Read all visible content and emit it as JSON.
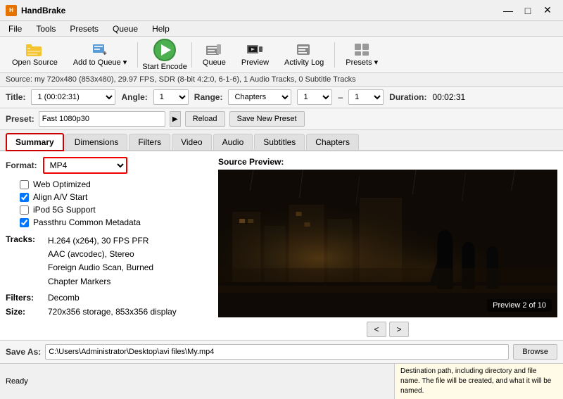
{
  "app": {
    "title": "HandBrake",
    "title_full": "HandBrake"
  },
  "titlebar": {
    "minimize": "—",
    "maximize": "□",
    "close": "✕"
  },
  "menubar": {
    "items": [
      "File",
      "Tools",
      "Presets",
      "Queue",
      "Help"
    ]
  },
  "toolbar": {
    "open_source": "Open Source",
    "add_to_queue": "Add to Queue",
    "start_encode": "Start Encode",
    "queue": "Queue",
    "preview": "Preview",
    "activity_log": "Activity Log",
    "presets": "Presets"
  },
  "source_bar": {
    "text": "Source: my  720x480 (853x480), 29.97 FPS, SDR (8-bit 4:2:0, 6-1-6), 1 Audio Tracks, 0 Subtitle Tracks"
  },
  "title_row": {
    "title_label": "Title:",
    "title_value": "1 (00:02:31)",
    "angle_label": "Angle:",
    "angle_value": "1",
    "range_label": "Range:",
    "range_value": "Chapters",
    "range_from": "1",
    "range_to": "1",
    "duration_label": "Duration:",
    "duration_value": "00:02:31"
  },
  "preset_row": {
    "label": "Preset:",
    "value": "Fast 1080p30",
    "reload_btn": "Reload",
    "save_btn": "Save New Preset"
  },
  "tabs": [
    {
      "label": "Summary",
      "active": true,
      "highlight": true
    },
    {
      "label": "Dimensions",
      "active": false
    },
    {
      "label": "Filters",
      "active": false
    },
    {
      "label": "Video",
      "active": false
    },
    {
      "label": "Audio",
      "active": false
    },
    {
      "label": "Subtitles",
      "active": false
    },
    {
      "label": "Chapters",
      "active": false
    }
  ],
  "summary": {
    "format_label": "Format:",
    "format_value": "MP4",
    "checkboxes": [
      {
        "label": "Web Optimized",
        "checked": false
      },
      {
        "label": "Align A/V Start",
        "checked": true
      },
      {
        "label": "iPod 5G Support",
        "checked": false
      },
      {
        "label": "Passthru Common Metadata",
        "checked": true
      }
    ],
    "tracks_label": "Tracks:",
    "tracks": [
      "H.264 (x264), 30 FPS PFR",
      "AAC (avcodec), Stereo",
      "Foreign Audio Scan, Burned",
      "Chapter Markers"
    ],
    "filters_label": "Filters:",
    "filters_value": "Decomb",
    "size_label": "Size:",
    "size_value": "720x356 storage, 853x356 display"
  },
  "preview": {
    "label": "Source Preview:",
    "counter": "Preview 2 of 10",
    "prev_btn": "<",
    "next_btn": ">"
  },
  "save": {
    "label": "Save As:",
    "path": "C:\\Users\\Administrator\\Desktop\\avi files\\My.mp4",
    "browse_btn": "Browse"
  },
  "statusbar": {
    "status": "Ready",
    "tooltip": "Destination path, including directory and file name. The file will be created, and what it will be named."
  },
  "colors": {
    "accent": "#0078d7",
    "highlight_red": "#cc0000",
    "play_green": "#4caf50"
  }
}
